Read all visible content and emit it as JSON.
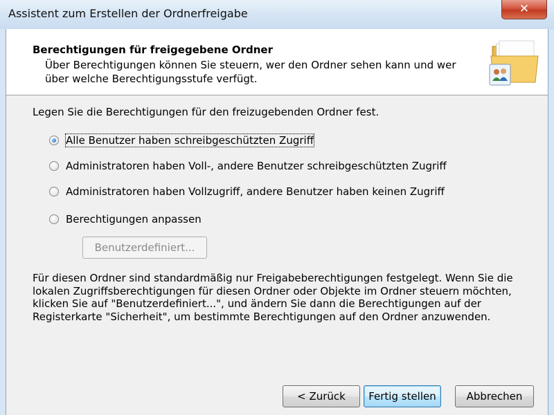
{
  "window": {
    "title": "Assistent zum Erstellen der Ordnerfreigabe",
    "close_glyph": "✕"
  },
  "header": {
    "title": "Berechtigungen für freigegebene Ordner",
    "subtitle": "Über Berechtigungen können Sie steuern, wer den Ordner sehen kann und wer über welche Berechtigungsstufe verfügt.",
    "icon": "shared-folder-users-icon"
  },
  "body": {
    "intro": "Legen Sie die Berechtigungen für den freizugebenden Ordner fest.",
    "options": [
      {
        "label": "Alle Benutzer haben schreibgeschützten Zugriff",
        "checked": true
      },
      {
        "label": "Administratoren haben Voll-, andere Benutzer schreibgeschützten Zugriff",
        "checked": false
      },
      {
        "label": "Administratoren haben Vollzugriff, andere Benutzer haben keinen Zugriff",
        "checked": false
      },
      {
        "label": "Berechtigungen anpassen",
        "checked": false
      }
    ],
    "custom_button": "Benutzerdefiniert...",
    "info": "Für diesen Ordner sind standardmäßig nur Freigabeberechtigungen festgelegt. Wenn Sie die lokalen Zugriffsberechtigungen für diesen Ordner oder Objekte im Ordner steuern möchten, klicken Sie auf \"Benutzerdefiniert...\", und ändern Sie dann die Berechtigungen auf der Registerkarte \"Sicherheit\", um bestimmte Berechtigungen auf den Ordner anzuwenden."
  },
  "footer": {
    "back": "< Zurück",
    "finish": "Fertig stellen",
    "cancel": "Abbrechen"
  },
  "colors": {
    "accent": "#1d5fa8",
    "close": "#c23b22"
  }
}
